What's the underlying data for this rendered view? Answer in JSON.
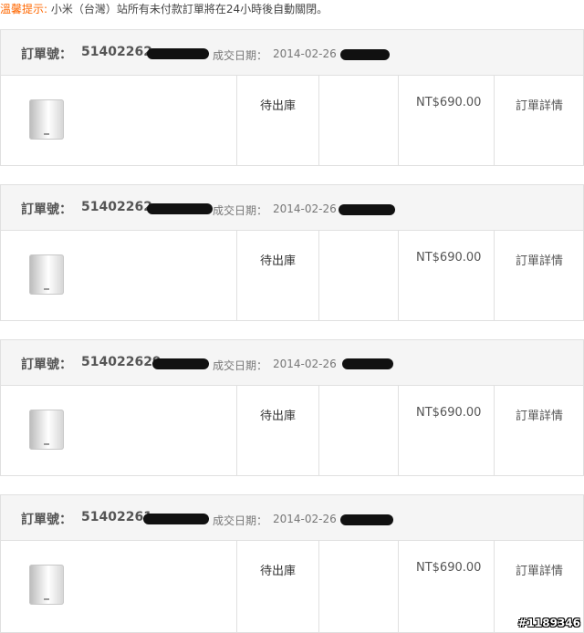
{
  "notice": {
    "label": "溫馨提示",
    "text": "小米（台灣）站所有未付款訂單將在24小時後自動關閉。"
  },
  "order_header": {
    "order_no_label": "訂單號：",
    "date_label": "成交日期："
  },
  "orders": [
    {
      "order_no": "51402262",
      "date": "2014-02-26",
      "status": "待出庫",
      "price": "NT$690.00",
      "detail_label": "訂單詳情"
    },
    {
      "order_no": "51402262",
      "date": "2014-02-26",
      "status": "待出庫",
      "price": "NT$690.00",
      "detail_label": "訂單詳情"
    },
    {
      "order_no": "514022629",
      "date": "2014-02-26",
      "status": "待出庫",
      "price": "NT$690.00",
      "detail_label": "訂單詳情"
    },
    {
      "order_no": "51402261",
      "date": "2014-02-26",
      "status": "待出庫",
      "price": "NT$690.00",
      "detail_label": "訂單詳情"
    }
  ],
  "watermark": "#1189346",
  "colors": {
    "accent": "#ff6700",
    "border": "#e0e0e0",
    "header_bg": "#f5f5f5"
  }
}
